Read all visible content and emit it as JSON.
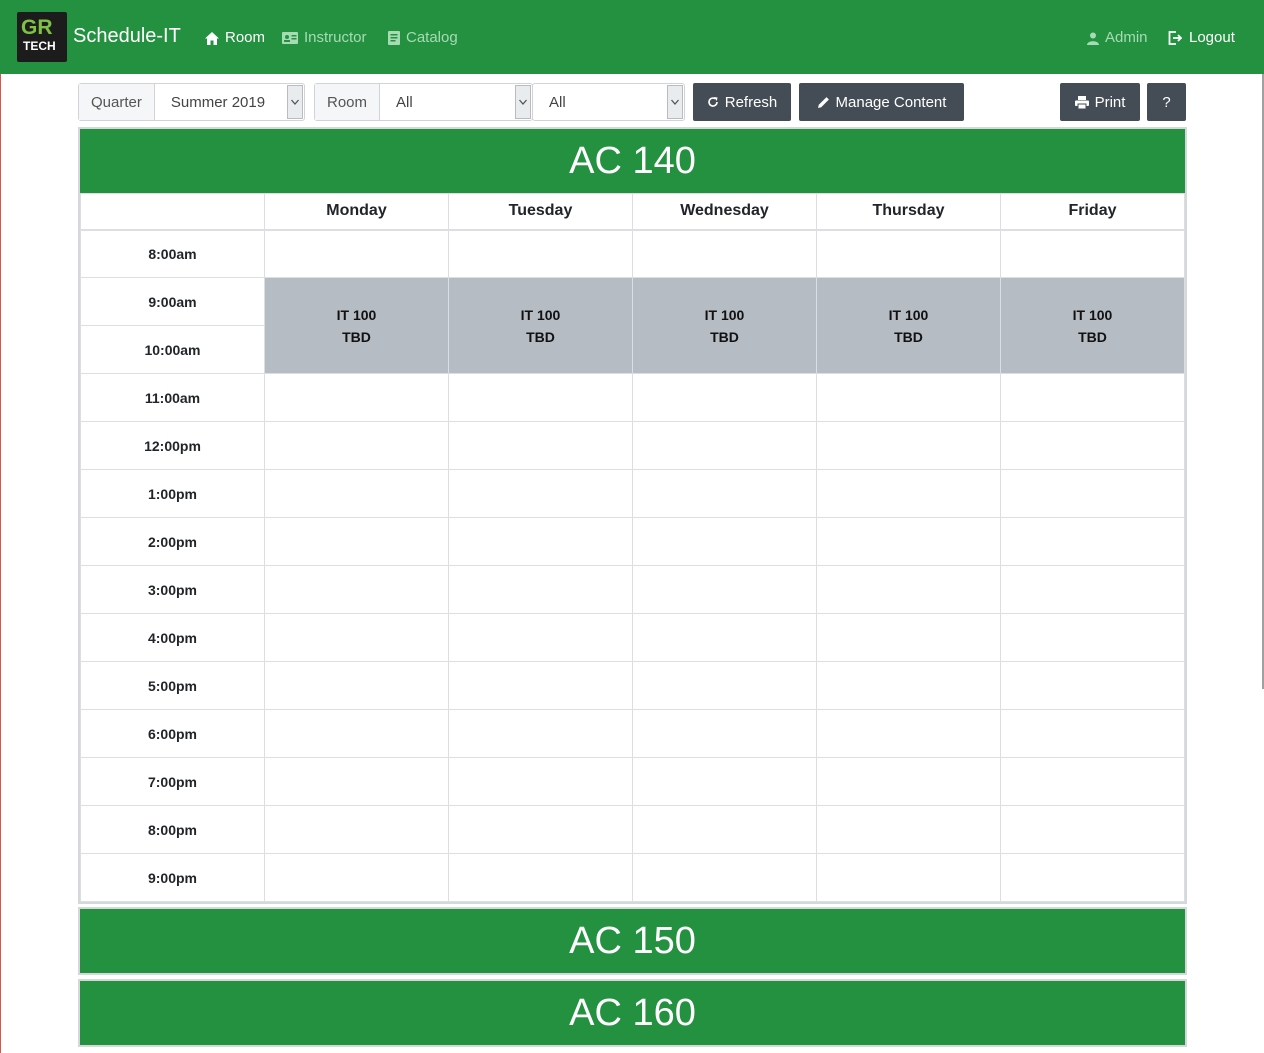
{
  "navbar": {
    "logo_top": "GR",
    "logo_bottom": "TECH",
    "brand": "Schedule-IT",
    "items": [
      {
        "label": "Room",
        "icon": "home-icon",
        "active": true
      },
      {
        "label": "Instructor",
        "icon": "id-card-icon",
        "active": false
      },
      {
        "label": "Catalog",
        "icon": "document-icon",
        "active": false
      }
    ],
    "admin_label": "Admin",
    "logout_label": "Logout"
  },
  "toolbar": {
    "quarter_label": "Quarter",
    "quarter_value": "Summer 2019",
    "room_label": "Room",
    "room_value": "All",
    "filter_value": "All",
    "refresh_label": "Refresh",
    "manage_label": "Manage Content",
    "print_label": "Print",
    "help_label": "?"
  },
  "colors": {
    "brand_green": "#239140",
    "class_block": "#b6bcc4",
    "button_dark": "#444d55"
  },
  "days": [
    "Monday",
    "Tuesday",
    "Wednesday",
    "Thursday",
    "Friday"
  ],
  "times": [
    "8:00am",
    "9:00am",
    "10:00am",
    "11:00am",
    "12:00pm",
    "1:00pm",
    "2:00pm",
    "3:00pm",
    "4:00pm",
    "5:00pm",
    "6:00pm",
    "7:00pm",
    "8:00pm",
    "9:00pm"
  ],
  "rooms": [
    {
      "name": "AC 140",
      "classes": [
        {
          "day": "Monday",
          "start": "9:00am",
          "end": "10:00am",
          "course": "IT 100",
          "instructor": "TBD"
        },
        {
          "day": "Tuesday",
          "start": "9:00am",
          "end": "10:00am",
          "course": "IT 100",
          "instructor": "TBD"
        },
        {
          "day": "Wednesday",
          "start": "9:00am",
          "end": "10:00am",
          "course": "IT 100",
          "instructor": "TBD"
        },
        {
          "day": "Thursday",
          "start": "9:00am",
          "end": "10:00am",
          "course": "IT 100",
          "instructor": "TBD"
        },
        {
          "day": "Friday",
          "start": "9:00am",
          "end": "10:00am",
          "course": "IT 100",
          "instructor": "TBD"
        }
      ]
    },
    {
      "name": "AC 150"
    },
    {
      "name": "AC 160"
    }
  ]
}
